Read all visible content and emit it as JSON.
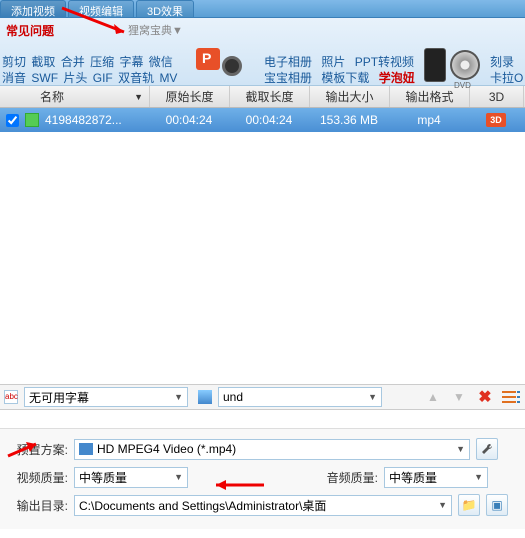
{
  "tabs": {
    "add": "添加视频",
    "edit": "视频编辑",
    "fx": "3D效果"
  },
  "faq": "常见问题",
  "li_bao": "狸窝宝典▼",
  "tool_row1": [
    "剪切",
    "截取",
    "合并",
    "压缩",
    "字幕",
    "微信"
  ],
  "tool_row2": [
    "消音",
    "SWF",
    "片头",
    "GIF",
    "双音轨",
    "MV"
  ],
  "links1": [
    "电子相册",
    "照片",
    "PPT转视频"
  ],
  "links2": [
    "宝宝相册",
    "模板下载"
  ],
  "links2_hot": "学泡妞",
  "right1": "刻录",
  "right2": "卡拉O",
  "headers": {
    "name": "名称",
    "orig": "原始长度",
    "cut": "截取长度",
    "size": "输出大小",
    "fmt": "输出格式",
    "d3": "3D"
  },
  "row": {
    "name": "4198482872...",
    "orig": "00:04:24",
    "cut": "00:04:24",
    "size": "153.36 MB",
    "fmt": "mp4",
    "badge": "3D"
  },
  "sub_ico": "abc",
  "subtitle": "无可用字幕",
  "audio": "und",
  "settings": {
    "preset_lbl": "预置方案:",
    "preset_val": "HD MPEG4 Video (*.mp4)",
    "vq_lbl": "视频质量:",
    "vq_val": "中等质量",
    "aq_lbl": "音频质量:",
    "aq_val": "中等质量",
    "out_lbl": "输出目录:",
    "out_val": "C:\\Documents and Settings\\Administrator\\桌面"
  }
}
